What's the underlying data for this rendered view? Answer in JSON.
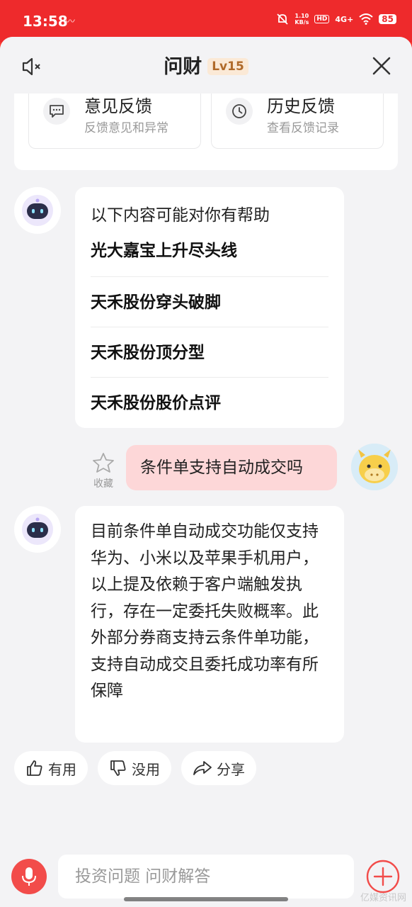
{
  "status_bar": {
    "time": "13:58",
    "net_speed_value": "1.10",
    "net_speed_unit": "KB/s",
    "hd": "HD",
    "signal": "4G+",
    "battery": "85"
  },
  "header": {
    "title": "问财",
    "level": "Lv15"
  },
  "feedback": {
    "left_title": "意见反馈",
    "left_sub": "反馈意见和异常",
    "right_title": "历史反馈",
    "right_sub": "查看反馈记录"
  },
  "suggestions": {
    "heading": "以下内容可能对你有帮助",
    "items": [
      "光大嘉宝上升尽头线",
      "天禾股份穿头破脚",
      "天禾股份顶分型",
      "天禾股份股价点评"
    ]
  },
  "user_message": {
    "text": "条件单支持自动成交吗",
    "favorite_label": "收藏"
  },
  "answer": {
    "text": "目前条件单自动成交功能仅支持华为、小米以及苹果手机用户，以上提及依赖于客户端触发执行，存在一定委托失败概率。此外部分券商支持云条件单功能，支持自动成交且委托成功率有所保障"
  },
  "actions": {
    "useful": "有用",
    "useless": "没用",
    "share": "分享"
  },
  "input": {
    "placeholder": "投资问题 问财解答"
  },
  "watermark": "亿媒资讯网",
  "colors": {
    "brand_red": "#ee2a2c",
    "user_bubble": "#fdd7d8",
    "level_badge": "#fbe9d6"
  }
}
